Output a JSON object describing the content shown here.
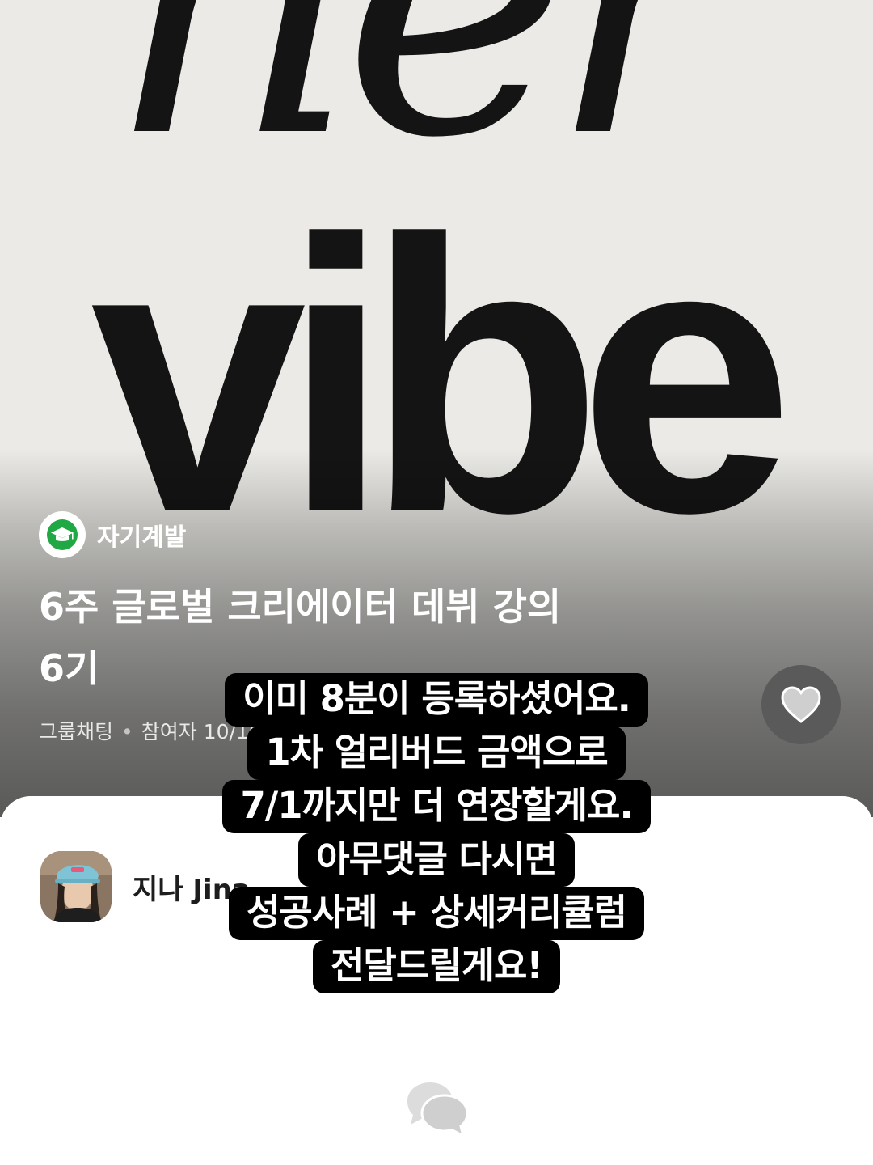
{
  "hero": {
    "word_top": "her",
    "word_bottom": "vibe"
  },
  "category": {
    "icon": "graduation-cap-icon",
    "icon_color": "#1fa843",
    "label": "자기계발"
  },
  "title": {
    "line1": "6주 글로벌 크리에이터 데뷔 강의",
    "line2": "6기"
  },
  "meta": {
    "type": "그룹채팅",
    "participants_label": "참여자",
    "participants_value": "10/10("
  },
  "like_button": {
    "icon": "heart-icon"
  },
  "host": {
    "name": "지나 Jina"
  },
  "chat": {
    "icon": "chat-bubbles-icon"
  },
  "caption": {
    "lines": [
      "이미 8분이 등록하셨어요.",
      "1차 얼리버드 금액으로",
      "7/1까지만 더 연장할게요.",
      "아무댓글 다시면",
      "성공사례 + 상세커리큘럼",
      "전달드릴게요!"
    ]
  }
}
